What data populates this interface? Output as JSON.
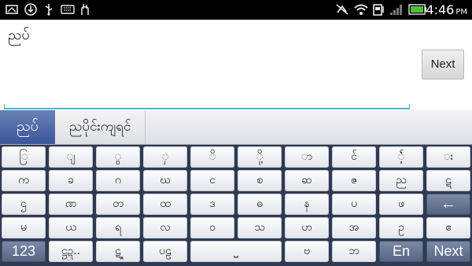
{
  "status_bar": {
    "clock": "4:46",
    "ampm": "PM",
    "left_icons": [
      "message-icon",
      "download-icon",
      "usb-icon",
      "keyboard-icon",
      "debug-icon"
    ],
    "right_icons": [
      "mute-icon",
      "wifi-icon",
      "data-icon",
      "signal-icon",
      "battery-icon"
    ]
  },
  "input": {
    "text": "ညပ်",
    "next_button": "Next"
  },
  "suggestions": {
    "active": "ညပ်",
    "items": [
      "ညပိုင်းကျရင်"
    ]
  },
  "keyboard": {
    "rows": [
      [
        "ြ",
        "ျ",
        "ွ",
        "ှ",
        "ိ",
        "ို့",
        "ာ",
        "င်",
        "ံ့်",
        "း"
      ],
      [
        "က",
        "ခ",
        "ဂ",
        "ဃ",
        "င",
        "စ",
        "ဆ",
        "ဇ",
        "ည",
        "ဋ"
      ],
      [
        "ဌ",
        "ဏ",
        "တ",
        "ထ",
        "ဒ",
        "ဓ",
        "န",
        "ပ",
        "ဖ",
        "←"
      ],
      [
        "မ",
        "ယ",
        "ရ",
        "လ",
        "ဝ",
        "သ",
        "ဟ",
        "အ",
        "ဥ",
        "ဧ"
      ]
    ],
    "bottom_row": {
      "numbers": "123",
      "k2": "ဋ္ဌဍ္..",
      "k3": "ဋ္ဍ",
      "k4": "ပဠ",
      "space": "⎵",
      "k6": "ဗ",
      "k7": "ဘ",
      "lang": "En",
      "next": "Next"
    }
  },
  "colors": {
    "keyboard_bg": "#2e3a52",
    "accent_blue": "#49b7d2",
    "active_suggestion": "#4a63a3"
  }
}
